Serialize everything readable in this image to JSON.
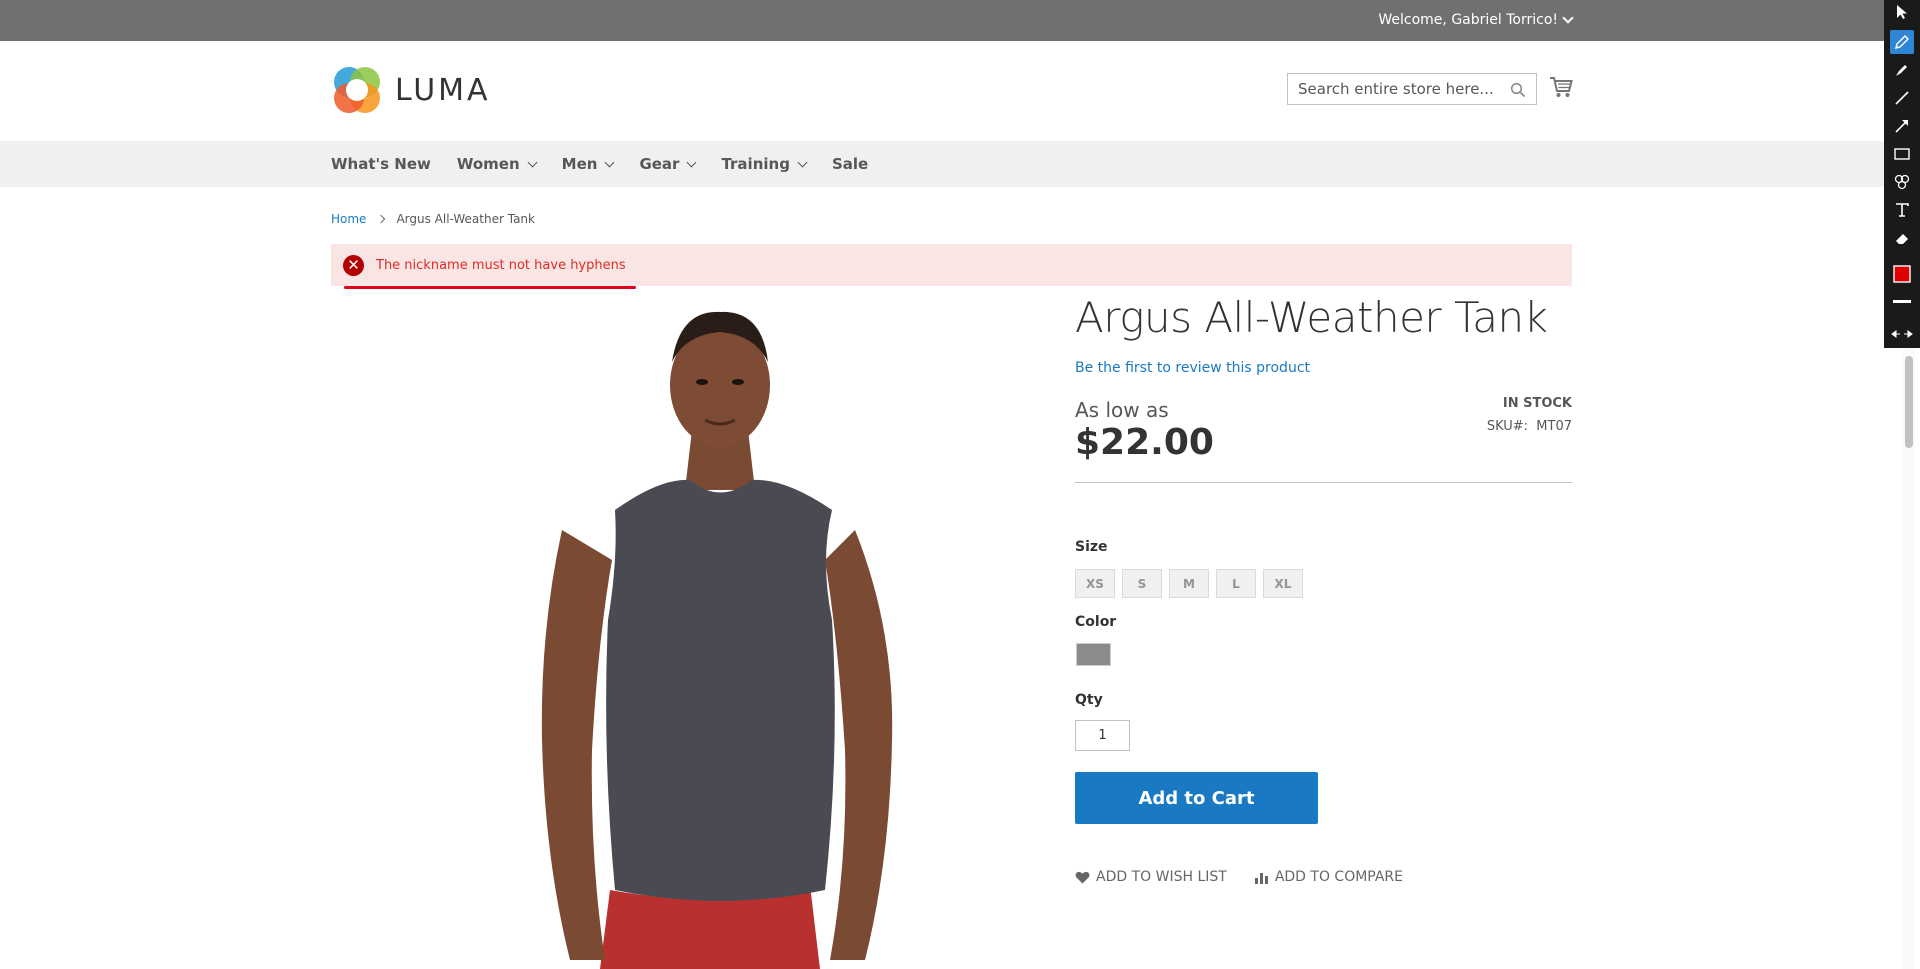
{
  "topbar": {
    "welcome": "Welcome, Gabriel Torrico!"
  },
  "header": {
    "logo_text": "LUMA",
    "search_placeholder": "Search entire store here..."
  },
  "nav": {
    "items": [
      {
        "label": "What's New",
        "has_menu": false
      },
      {
        "label": "Women",
        "has_menu": true
      },
      {
        "label": "Men",
        "has_menu": true
      },
      {
        "label": "Gear",
        "has_menu": true
      },
      {
        "label": "Training",
        "has_menu": true
      },
      {
        "label": "Sale",
        "has_menu": false
      }
    ]
  },
  "breadcrumb": {
    "home": "Home",
    "current": "Argus All-Weather Tank"
  },
  "error": {
    "message": "The nickname must not have hyphens",
    "accent": "#e02b27"
  },
  "product": {
    "title": "Argus All-Weather Tank",
    "review_link": "Be the first to review this product",
    "price_label": "As low as",
    "price": "$22.00",
    "stock": "IN STOCK",
    "sku_label": "SKU#:",
    "sku": "MT07",
    "size_label": "Size",
    "sizes": [
      "XS",
      "S",
      "M",
      "L",
      "XL"
    ],
    "color_label": "Color",
    "color_swatch": "#8b8b8b",
    "qty_label": "Qty",
    "qty": "1",
    "add_to_cart": "Add to Cart",
    "wishlist": "Add to Wish List",
    "compare": "Add to Compare"
  },
  "colors": {
    "brand": "#1979c3",
    "topbar": "#6e716e",
    "nav_bg": "#f0f0f0"
  },
  "annotation_toolbar": {
    "tools": [
      "pointer-icon",
      "pencil-icon",
      "marker-icon",
      "line-icon",
      "arrow-icon",
      "rectangle-icon",
      "stamp-icon",
      "text-icon",
      "eraser-icon",
      "color-icon",
      "stroke-width-icon",
      "collapse-icon"
    ],
    "active": "pencil-icon",
    "color": "#e00000"
  }
}
